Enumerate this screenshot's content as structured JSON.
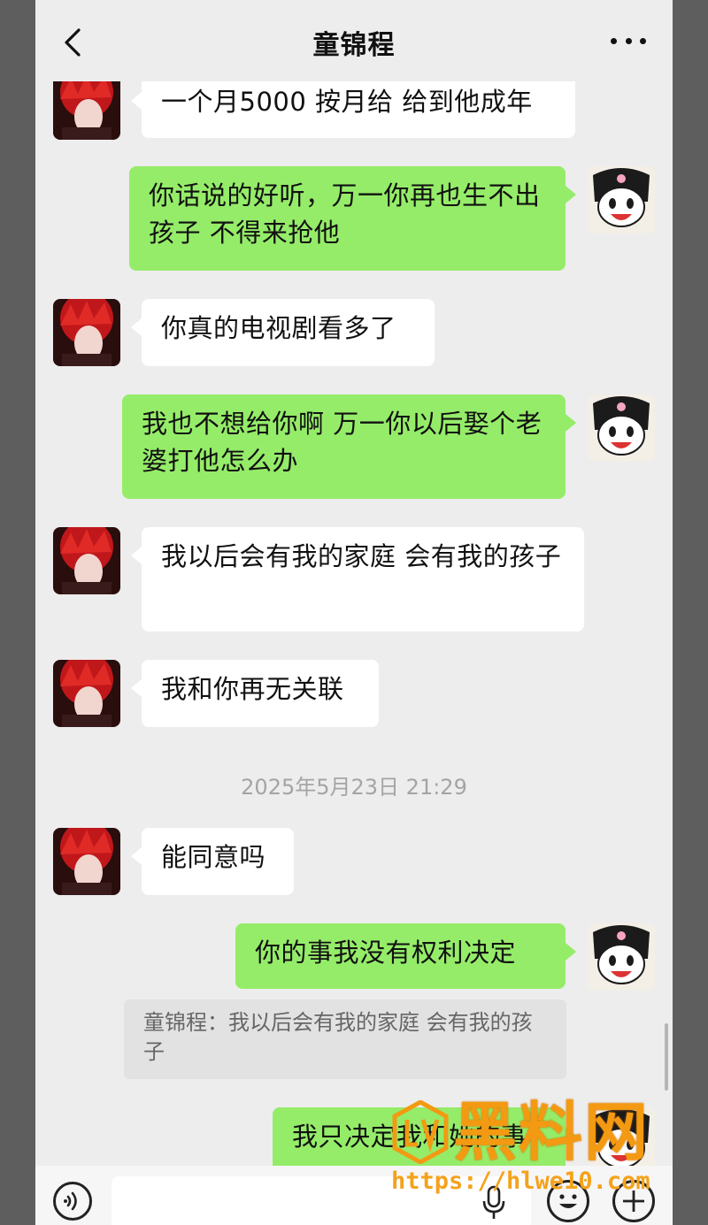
{
  "header": {
    "title": "童锦程",
    "back_icon": "chevron-left-icon",
    "more_icon": "more-dots-icon"
  },
  "messages": [
    {
      "side": "left",
      "text": "一个月5000 按月给 给到他成年"
    },
    {
      "side": "right",
      "text": "你话说的好听，万一你再也生不出孩子 不得来抢他"
    },
    {
      "side": "left",
      "text": "你真的电视剧看多了"
    },
    {
      "side": "right",
      "text": "我也不想给你啊 万一你以后娶个老婆打他怎么办"
    },
    {
      "side": "left",
      "text": "我以后会有我的家庭 会有我的孩子"
    },
    {
      "side": "left",
      "text": "我和你再无关联"
    },
    {
      "side": "left",
      "text": "能同意吗"
    },
    {
      "side": "right",
      "text": "你的事我没有权利决定"
    },
    {
      "side": "right",
      "text": "我只决定我和她的事"
    }
  ],
  "timestamp": "2025年5月23日 21:29",
  "quote": {
    "text": "童锦程：我以后会有我的家庭 会有我的孩子"
  },
  "input_bar": {
    "voice_icon": "voice-icon",
    "mic_icon": "mic-icon",
    "emoji_icon": "emoji-icon",
    "plus_icon": "plus-icon"
  },
  "watermark": {
    "brand": "黑料网",
    "url": "https://hlwe10.com"
  },
  "colors": {
    "chat_bg": "#ededed",
    "right_bubble": "#95ec69",
    "left_bubble": "#ffffff",
    "watermark": "#f39a12"
  }
}
